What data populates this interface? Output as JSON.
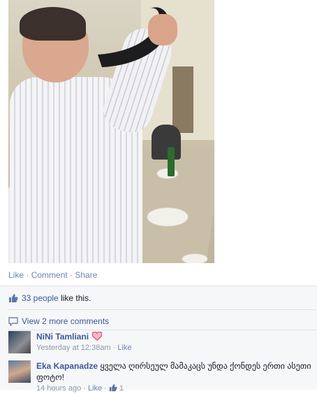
{
  "post": {
    "actions": {
      "like": "Like",
      "comment": "Comment",
      "share": "Share",
      "sep": " · "
    }
  },
  "likes": {
    "count_text": "33 people",
    "suffix": " like this."
  },
  "view_more": {
    "label": "View 2 more comments"
  },
  "comments": [
    {
      "author": "NiNi Tamliani",
      "text": "",
      "time": "Yesterday at 12:38am",
      "like_label": "Like",
      "emoticon": "heart-icon",
      "heart_color": "#e0245e"
    },
    {
      "author": "Eka Kapanadze",
      "text": "ყველა ღირსეულ მამაკაცს უნდა ქონდეს ერთი ასეთი ფოტო!",
      "time": "14 hours ago",
      "like_label": "Like",
      "like_count": "1"
    }
  ],
  "colors": {
    "link": "#3b5998",
    "action": "#6d84b4",
    "panel_bg": "#f6f7f9"
  }
}
